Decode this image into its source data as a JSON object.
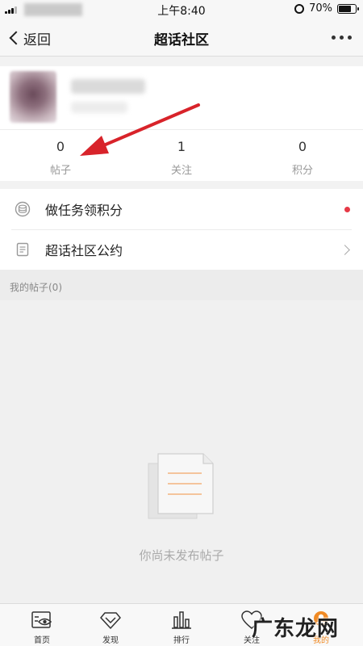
{
  "status": {
    "time": "上午8:40",
    "battery": "70%",
    "battery_level": 0.7
  },
  "nav": {
    "back_label": "返回",
    "title": "超话社区"
  },
  "profile": {
    "stats": [
      {
        "value": "0",
        "label": "帖子"
      },
      {
        "value": "1",
        "label": "关注"
      },
      {
        "value": "0",
        "label": "积分"
      }
    ]
  },
  "menu": [
    {
      "label": "做任务领积分",
      "icon": "coin-stack-icon"
    },
    {
      "label": "超话社区公约",
      "icon": "document-icon"
    }
  ],
  "posts": {
    "header": "我的帖子(0)",
    "empty_text": "你尚未发布帖子"
  },
  "tabs": [
    {
      "label": "首页",
      "icon": "eye-card-icon"
    },
    {
      "label": "发现",
      "icon": "diamond-icon"
    },
    {
      "label": "排行",
      "icon": "bar-chart-icon"
    },
    {
      "label": "关注",
      "icon": "heart-icon"
    },
    {
      "label": "我的",
      "icon": "profile-icon",
      "active": true
    }
  ],
  "watermark": "广东龙网",
  "colors": {
    "accent": "#f08a24",
    "arrow": "#d8232a",
    "dot": "#e63946"
  }
}
